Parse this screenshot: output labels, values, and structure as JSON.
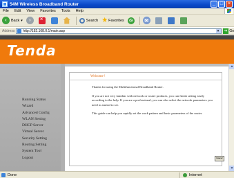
{
  "window": {
    "title": "54M Wireless Broadband Router"
  },
  "menu": [
    "File",
    "Edit",
    "View",
    "Favorites",
    "Tools",
    "Help"
  ],
  "toolbar": {
    "back_label": "Back",
    "search_label": "Search",
    "favorites_label": "Favorites"
  },
  "address": {
    "label": "Address",
    "url": "http://192.168.0.1/main.asp",
    "go_label": "Go"
  },
  "brand": {
    "logo_text": "Tenda"
  },
  "sidebar": {
    "items": [
      "Running Status",
      "Wizard",
      "Advanced Config",
      "WLAN Setting",
      "DHCP Server",
      "Virtual Server",
      "Security Setting",
      "Routing Setting",
      "System Tool",
      "Logout"
    ]
  },
  "main": {
    "welcome_title": "Welcome !",
    "paragraphs": [
      "Thanks for using the Multifunctional Broadband Router.",
      "If you are not very familiar with network or router products, you can finish setting easily according to the help. If you are a professional, you can also select the network parameters you need to amend to set.",
      "This guide can help you rapidly set the work pattern and basic parameters of the router."
    ],
    "next_label": "Next"
  },
  "status": {
    "text": "Done",
    "zone": "Internet"
  }
}
